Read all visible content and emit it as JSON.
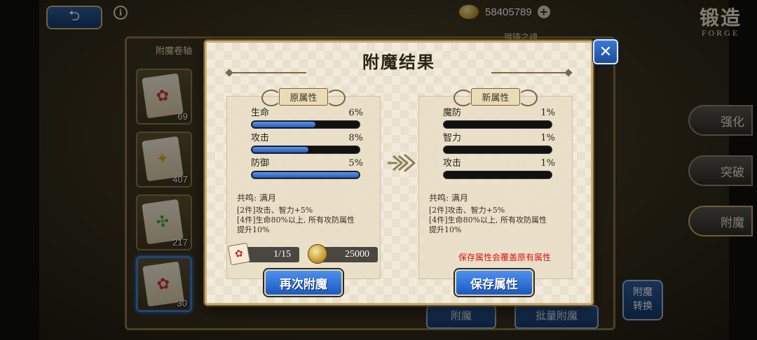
{
  "header": {
    "back_icon": "back-arrow-icon",
    "info_icon": "info-icon",
    "currency_amount": "58405789",
    "plus_label": "+",
    "forge_title_cn": "锻造",
    "forge_title_en": "FORGE"
  },
  "sidebar": {
    "title": "附魔卷轴",
    "items": [
      {
        "count": "69",
        "glyph": "✿",
        "selected": false
      },
      {
        "count": "407",
        "glyph": "✦",
        "selected": false
      },
      {
        "count": "217",
        "glyph": "✣",
        "selected": false
      },
      {
        "count": "30",
        "glyph": "✿",
        "selected": true
      }
    ]
  },
  "background": {
    "top_partial_label": "镀铸之魂",
    "tab_strengthen": "强化",
    "tab_breakthrough": "突破",
    "tab_enchant": "附魔",
    "convert_label_1": "附魔",
    "convert_label_2": "转换",
    "bottom_btn_1": "附魔",
    "bottom_btn_2": "批量附魔"
  },
  "modal": {
    "title": "附魔结果",
    "close_label": "✕",
    "original": {
      "label": "原属性",
      "stats": [
        {
          "name": "生命",
          "value": "6%",
          "fill": 0.6
        },
        {
          "name": "攻击",
          "value": "8%",
          "fill": 0.53
        },
        {
          "name": "防御",
          "value": "5%",
          "fill": 1.0
        }
      ],
      "resonance_title": "共鸣: 满月",
      "resonance_2": "[2件]攻击、智力+5%",
      "resonance_4a": "[4件]生命80%以上, 所有攻防属性",
      "resonance_4b": "提升10%"
    },
    "new": {
      "label": "新属性",
      "stats": [
        {
          "name": "魔防",
          "value": "1%",
          "fill": 0
        },
        {
          "name": "智力",
          "value": "1%",
          "fill": 0
        },
        {
          "name": "攻击",
          "value": "1%",
          "fill": 0
        }
      ],
      "resonance_title": "共鸣: 满月",
      "resonance_2": "[2件]攻击、智力+5%",
      "resonance_4a": "[4件]生命80%以上, 所有攻防属性",
      "resonance_4b": "提升10%"
    },
    "cost_scroll": "1/15",
    "cost_gold": "25000",
    "warning": "保存属性会覆盖原有属性",
    "reenchant_label": "再次附魔",
    "save_label": "保存属性"
  },
  "colors": {
    "bar_fill": "#2e67cc",
    "warning": "#dd1111",
    "button_blue": "#2a66d0"
  }
}
